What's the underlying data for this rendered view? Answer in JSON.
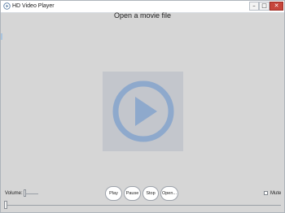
{
  "window": {
    "title": "HD Video Player",
    "controls": {
      "minimize": "–",
      "maximize": "□",
      "close": "✕"
    }
  },
  "header": {
    "text": "Open a movie file"
  },
  "video": {
    "placeholder_icon": "play-circle-icon",
    "icon_color": "#8ea9cc"
  },
  "controls": {
    "volume_label": "Volume:",
    "volume_level": 0.0,
    "play_label": "Play",
    "pause_label": "Pause",
    "stop_label": "Stop",
    "open_label": "Open...",
    "mute_label": "Mute",
    "mute_checked": false,
    "seek_position": 0.0
  }
}
